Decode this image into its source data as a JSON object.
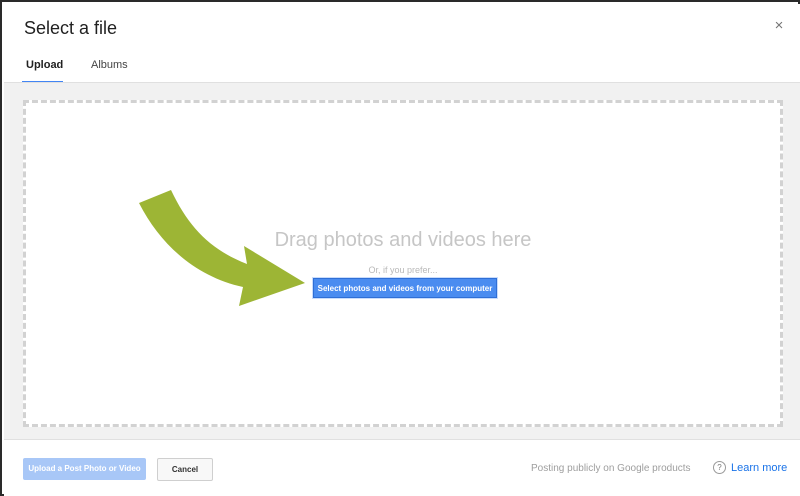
{
  "dialog": {
    "title": "Select a file",
    "close_glyph": "×"
  },
  "tabs": [
    {
      "label": "Upload",
      "active": true
    },
    {
      "label": "Albums",
      "active": false
    }
  ],
  "dropzone": {
    "drag_text": "Drag photos and videos here",
    "prefer_text": "Or, if you prefer...",
    "select_button_label": "Select photos and videos from your computer",
    "arrow_color": "#9db535"
  },
  "footer": {
    "upload_button_label": "Upload a Post Photo or Video",
    "cancel_button_label": "Cancel",
    "posting_text": "Posting publicly on Google products",
    "help_glyph": "?",
    "learn_more_label": "Learn more"
  },
  "colors": {
    "accent": "#4285f4",
    "select_button": "#4a8cf0",
    "upload_button_disabled": "#a8c7f7",
    "link": "#1a73e8"
  }
}
